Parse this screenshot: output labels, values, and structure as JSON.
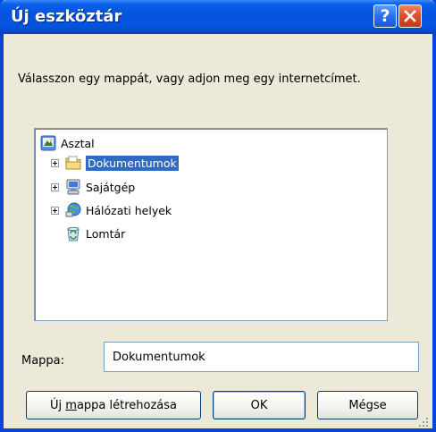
{
  "window": {
    "title": "Új eszköztár",
    "help_label": "?"
  },
  "dialog": {
    "prompt": "Válasszon egy mappát, vagy adjon meg egy internetcímet."
  },
  "tree": {
    "root": {
      "label": "Asztal",
      "icon": "desktop-icon"
    },
    "items": [
      {
        "label": "Dokumentumok",
        "icon": "folder-documents-icon",
        "expandable": true,
        "selected": true
      },
      {
        "label": "Sajátgép",
        "icon": "my-computer-icon",
        "expandable": true,
        "selected": false
      },
      {
        "label": "Hálózati helyek",
        "icon": "network-places-icon",
        "expandable": true,
        "selected": false
      },
      {
        "label": "Lomtár",
        "icon": "recycle-bin-icon",
        "expandable": false,
        "selected": false
      }
    ]
  },
  "folder_field": {
    "label": "Mappa:",
    "value": "Dokumentumok"
  },
  "buttons": {
    "new_folder_pre": "Új ",
    "new_folder_accel": "m",
    "new_folder_post": "appa létrehozása",
    "ok": "OK",
    "cancel": "Mégse"
  },
  "colors": {
    "titlebar": "#0553e1",
    "selection": "#316ac5",
    "dialog_bg": "#ece9d8",
    "close_button": "#e0512b"
  }
}
